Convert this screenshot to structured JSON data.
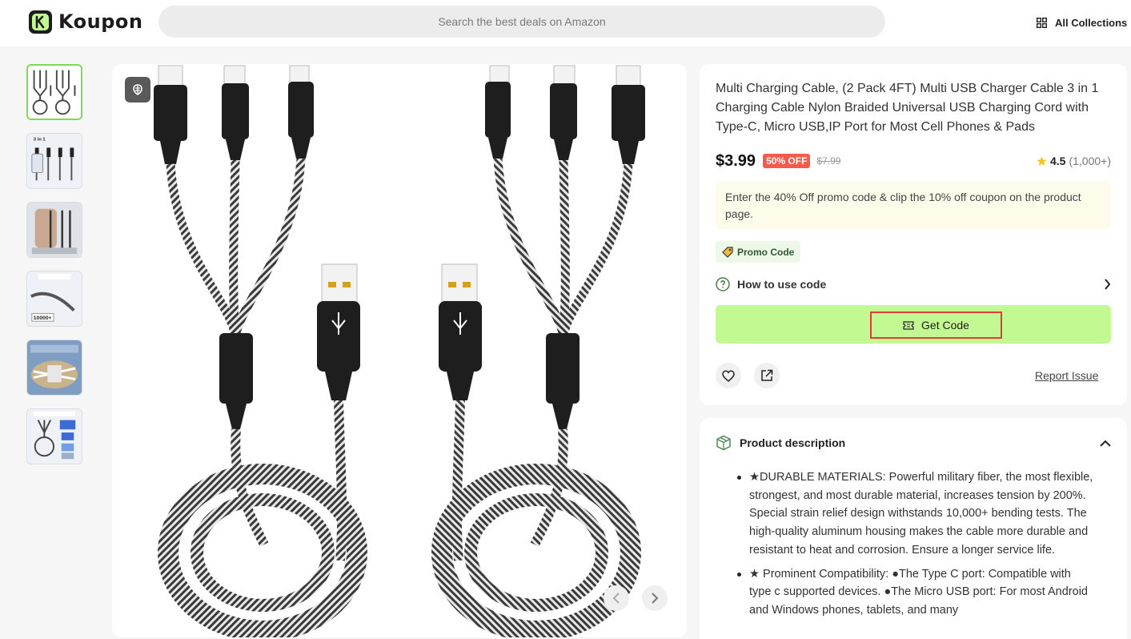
{
  "header": {
    "brand": "Koupon",
    "search_placeholder": "Search the best deals on Amazon",
    "collections_label": "All Collections"
  },
  "thumbnails": [
    {
      "name": "cable-bundle",
      "active": true
    },
    {
      "name": "3-in-1-charging",
      "caption": "3 in 1"
    },
    {
      "name": "in-hand"
    },
    {
      "name": "flexible-durable",
      "caption": "10000+"
    },
    {
      "name": "braided-nylon"
    },
    {
      "name": "broad-compatibility"
    }
  ],
  "product": {
    "title": "Multi Charging Cable, (2 Pack 4FT) Multi USB Charger Cable 3 in 1 Charging Cable Nylon Braided Universal USB Charging Cord with Type-C, Micro USB,IP Port for Most Cell Phones & Pads",
    "price": "$3.99",
    "discount": "50% OFF",
    "original_price": "$7.99",
    "rating": "4.5",
    "rating_count": "(1,000+)",
    "promo_note": "Enter the 40% Off promo code & clip the 10% off coupon on the product page.",
    "promo_tag": "Promo Code",
    "howto_label": "How to use code",
    "get_code_label": "Get Code",
    "report_label": "Report Issue"
  },
  "description": {
    "title": "Product description",
    "bullets": [
      "★DURABLE MATERIALS: Powerful military fiber, the most flexible, strongest, and most durable material, increases tension by 200%. Special strain relief design withstands 10,000+ bending tests. The high-quality aluminum housing makes the cable more durable and resistant to heat and corrosion. Ensure a longer service life.",
      "★ Prominent Compatibility: ●The Type C port: Compatible with type c supported devices. ●The Micro USB port: For most Android and Windows phones, tablets, and many"
    ]
  },
  "colors": {
    "accent_green": "#c2f993",
    "discount_red": "#f45b4a",
    "highlight_border": "#e23b3b",
    "star": "#f7c51e"
  }
}
